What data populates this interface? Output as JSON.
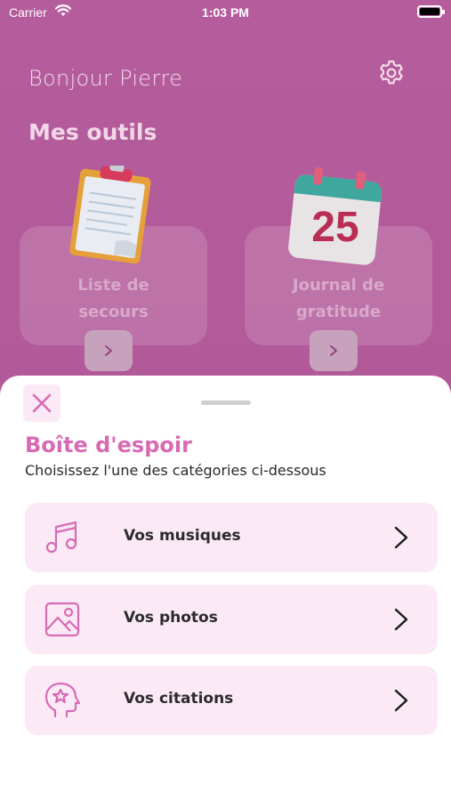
{
  "status_bar": {
    "carrier": "Carrier",
    "time": "1:03 PM"
  },
  "header": {
    "greeting": "Bonjour Pierre",
    "section_title": "Mes outils"
  },
  "tools": [
    {
      "label_line1": "Liste de",
      "label_line2": "secours",
      "button": "›"
    },
    {
      "label_line1": "Journal de",
      "label_line2": "gratitude",
      "button": "›",
      "calendar_day": "25"
    }
  ],
  "sheet": {
    "title": "Boîte d'espoir",
    "subtitle": "Choisissez l'une des catégories ci-dessous",
    "items": [
      {
        "label": "Vos musiques",
        "icon": "music-icon"
      },
      {
        "label": "Vos photos",
        "icon": "image-icon"
      },
      {
        "label": "Vos citations",
        "icon": "mind-icon"
      }
    ]
  },
  "colors": {
    "accent": "#d86ab4",
    "background": "#b25a99",
    "row_bg": "#fbeaf6"
  }
}
